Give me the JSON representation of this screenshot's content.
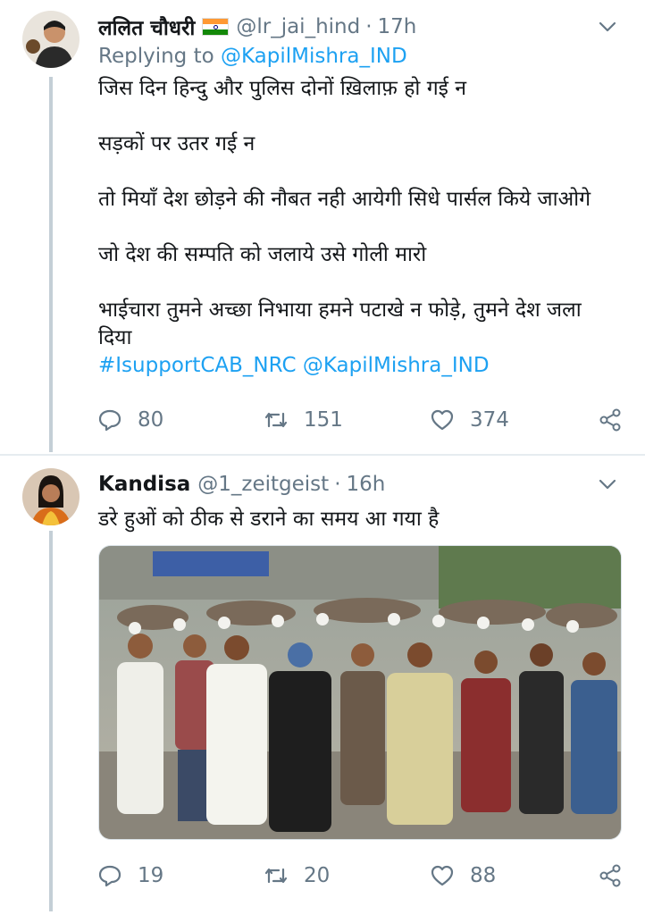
{
  "tweets": [
    {
      "name": "ललित चौधरी",
      "handle": "@lr_jai_hind",
      "dot": "·",
      "time": "17h",
      "replying_prefix": "Replying to ",
      "replying_to": "@KapilMishra_IND",
      "paragraphs": [
        "जिस दिन हिन्दु और पुलिस दोनों ख़िलाफ़ हो गई न",
        "सड़कों पर उतर गई न",
        "तो मियाँ देश छोड़ने की नौबत नही आयेगी सिधे पार्सल किये जाओगे",
        "जो देश की सम्पति को जलाये उसे गोली मारो",
        "भाईचारा तुमने अच्छा निभाया हमने पटाखे न फोड़े, तुमने देश जला दिया"
      ],
      "hashtags": "#IsupportCAB_NRC @KapilMishra_IND",
      "replies": "80",
      "retweets": "151",
      "likes": "374"
    },
    {
      "name": "Kandisa",
      "handle": "@1_zeitgeist",
      "dot": "·",
      "time": "16h",
      "text": "डरे हुओं को ठीक से डराने का समय आ गया है",
      "replies": "19",
      "retweets": "20",
      "likes": "88"
    }
  ],
  "colors": {
    "text": "#14171a",
    "secondary": "#657786",
    "link": "#1da1f2",
    "flag_saffron": "#ff9933",
    "flag_green": "#138808",
    "flag_chakra": "#000080"
  },
  "icons": [
    "chevron-down-icon",
    "reply-icon",
    "retweet-icon",
    "like-icon",
    "share-icon",
    "india-flag-icon"
  ]
}
